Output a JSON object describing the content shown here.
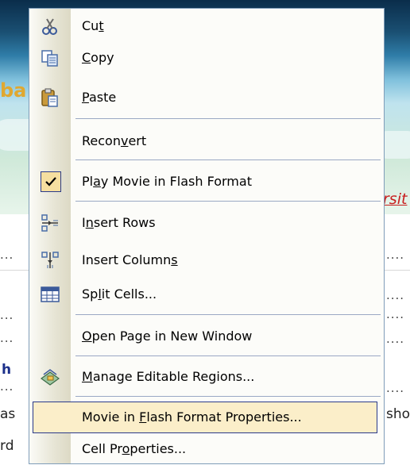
{
  "background": {
    "banner_left_fragment": "ba",
    "banner_right_fragment": "rsit",
    "dots_left": "...",
    "dots_right": "....",
    "text_h": "h",
    "text_as": "as",
    "text_rd": "rd",
    "text_sho": "sho"
  },
  "menu": {
    "items": [
      {
        "label_pre": "Cu",
        "label_key": "t",
        "label_post": "",
        "icon": "scissors-icon"
      },
      {
        "label_pre": "",
        "label_key": "C",
        "label_post": "opy",
        "icon": "copy-icon"
      },
      {
        "label_pre": "",
        "label_key": "P",
        "label_post": "aste",
        "icon": "paste-icon"
      },
      {
        "label_pre": "Recon",
        "label_key": "v",
        "label_post": "ert",
        "icon": ""
      },
      {
        "label_pre": "Pl",
        "label_key": "a",
        "label_post": "y Movie in Flash Format",
        "icon": "checkmark-icon"
      },
      {
        "label_pre": "I",
        "label_key": "n",
        "label_post": "sert Rows",
        "icon": "insert-rows-icon"
      },
      {
        "label_pre": "Insert Column",
        "label_key": "s",
        "label_post": "",
        "icon": "insert-columns-icon"
      },
      {
        "label_pre": "Sp",
        "label_key": "l",
        "label_post": "it Cells...",
        "icon": "split-cells-icon"
      },
      {
        "label_pre": "",
        "label_key": "O",
        "label_post": "pen Page in New Window",
        "icon": ""
      },
      {
        "label_pre": "",
        "label_key": "M",
        "label_post": "anage Editable Regions...",
        "icon": "editable-regions-icon"
      },
      {
        "label_pre": "Movie in ",
        "label_key": "F",
        "label_post": "lash Format Properties...",
        "icon": ""
      },
      {
        "label_pre": "Cell Pr",
        "label_key": "o",
        "label_post": "perties...",
        "icon": ""
      }
    ]
  },
  "colors": {
    "highlight_fill": "#fbeec9",
    "highlight_border": "#2a3a8a",
    "menu_border": "#7f9db9"
  }
}
